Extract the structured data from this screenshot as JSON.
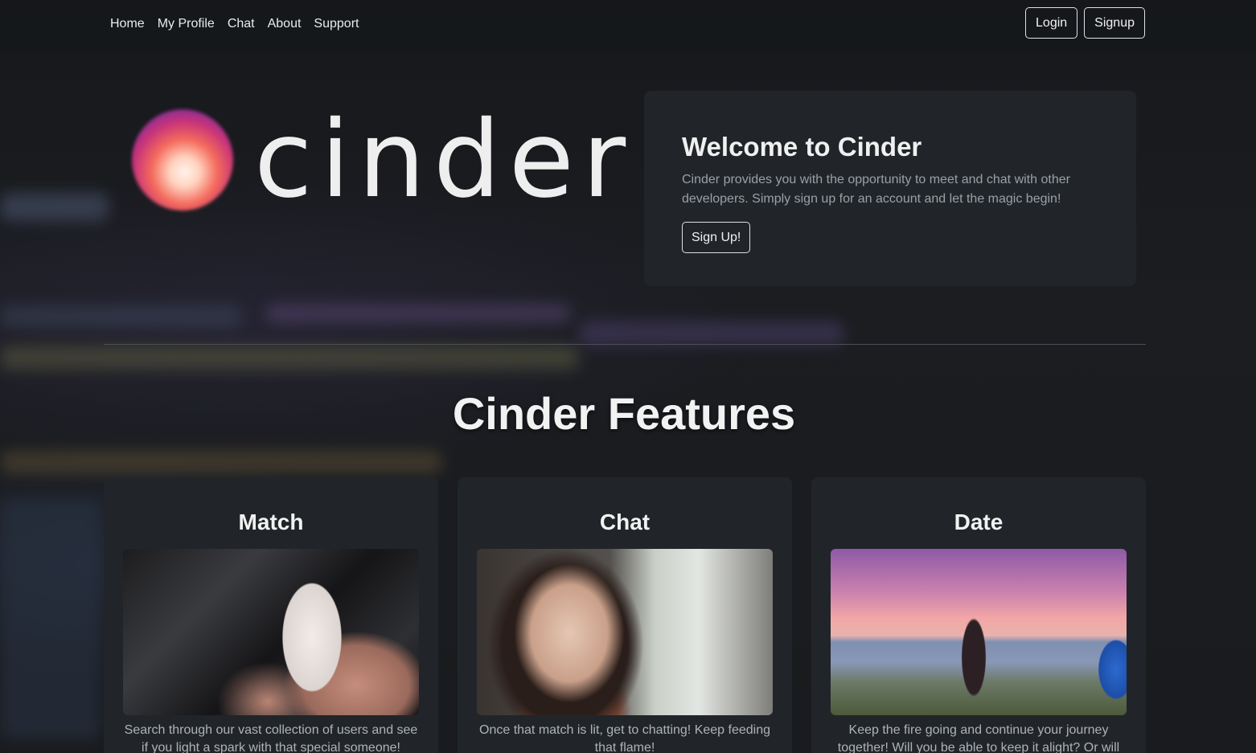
{
  "nav": {
    "links": [
      "Home",
      "My Profile",
      "Chat",
      "About",
      "Support"
    ],
    "login_label": "Login",
    "signup_label": "Signup"
  },
  "logo": {
    "text": "cinder"
  },
  "welcome": {
    "title": "Welcome to Cinder",
    "text": "Cinder provides you with the opportunity to meet and chat with other developers. Simply sign up for an account and let the magic begin!",
    "button_label": "Sign Up!"
  },
  "features": {
    "title": "Cinder Features",
    "cards": [
      {
        "title": "Match",
        "text": "Search through our vast collection of users and see if you light a spark with that special someone!"
      },
      {
        "title": "Chat",
        "text": "Once that match is lit, get to chatting! Keep feeding that flame!"
      },
      {
        "title": "Date",
        "text": "Keep the fire going and continue your journey together! Will you be able to keep it alight? Or will"
      }
    ]
  },
  "colors": {
    "card_bg": "#212529",
    "page_bg": "#1a1c1f",
    "logo_orb_top": "#c8337a",
    "logo_orb_bottom": "#fff3ec"
  }
}
